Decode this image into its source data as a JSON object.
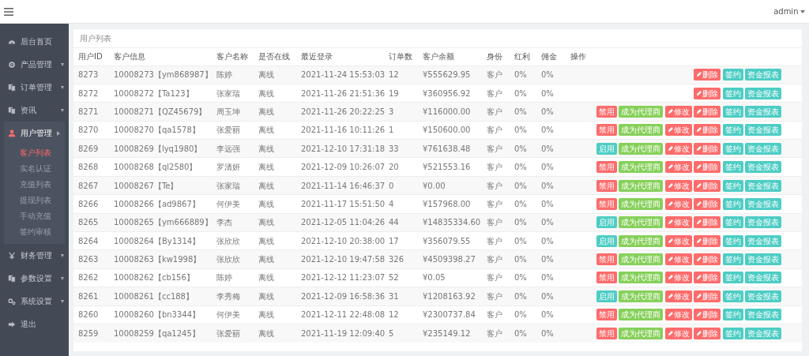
{
  "topbar": {
    "user": "admin"
  },
  "sidebar": {
    "items": [
      {
        "label": "后台首页",
        "selected": false
      },
      {
        "label": "产品管理",
        "selected": false,
        "expanded": false
      },
      {
        "label": "订单管理",
        "selected": false,
        "expanded": false
      },
      {
        "label": "资讯",
        "selected": false,
        "expanded": false
      },
      {
        "label": "用户管理",
        "selected": true,
        "expanded": true,
        "children": [
          {
            "label": "客户列表",
            "selected": true
          },
          {
            "label": "实名认证",
            "selected": false
          },
          {
            "label": "充值列表",
            "selected": false
          },
          {
            "label": "提现列表",
            "selected": false
          },
          {
            "label": "手动充值",
            "selected": false
          },
          {
            "label": "签约审核",
            "selected": false
          }
        ]
      },
      {
        "label": "财务管理",
        "selected": false,
        "expanded": false
      },
      {
        "label": "参数设置",
        "selected": false,
        "expanded": false
      },
      {
        "label": "系统设置",
        "selected": false,
        "expanded": false
      },
      {
        "label": "退出",
        "selected": false
      }
    ]
  },
  "panel": {
    "title": "用户列表",
    "table": {
      "columns": [
        "用户ID",
        "客户信息",
        "客户名称",
        "是否在线",
        "最近登录",
        "订单数",
        "客户余额",
        "身份",
        "红利",
        "佣金",
        "操作"
      ],
      "rows": [
        {
          "cells": [
            "8273",
            "10008273【ym868987】",
            "陈婷",
            "离线",
            "2021-11-24 15:53:03",
            "12",
            "¥555629.95",
            "客户",
            "0%",
            "0%"
          ],
          "actions": [
            {
              "label": "删除",
              "kind": "edit"
            },
            {
              "label": "签约",
              "kind": "info"
            },
            {
              "label": "资金报表",
              "kind": "info"
            }
          ]
        },
        {
          "cells": [
            "8272",
            "10008272【Ta123】",
            "张家瑞",
            "离线",
            "2021-11-26 21:51:36",
            "19",
            "¥360956.92",
            "客户",
            "0%",
            "0%"
          ],
          "actions": [
            {
              "label": "删除",
              "kind": "edit"
            },
            {
              "label": "签约",
              "kind": "info"
            },
            {
              "label": "资金报表",
              "kind": "info"
            }
          ]
        },
        {
          "cells": [
            "8271",
            "10008271【QZ45679】",
            "周玉坤",
            "离线",
            "2021-11-26 20:22:25",
            "3",
            "¥116000.00",
            "客户",
            "0%",
            "0%"
          ],
          "actions": [
            {
              "label": "禁用",
              "kind": "danger"
            },
            {
              "label": "成为代理商",
              "kind": "success"
            },
            {
              "label": "修改",
              "kind": "edit"
            },
            {
              "label": "删除",
              "kind": "edit"
            },
            {
              "label": "签约",
              "kind": "info"
            },
            {
              "label": "资金报表",
              "kind": "info"
            }
          ]
        },
        {
          "cells": [
            "8270",
            "10008270【qa1578】",
            "张爱丽",
            "离线",
            "2021-11-16 10:11:26",
            "1",
            "¥150600.00",
            "客户",
            "0%",
            "0%"
          ],
          "actions": [
            {
              "label": "禁用",
              "kind": "danger"
            },
            {
              "label": "成为代理商",
              "kind": "success"
            },
            {
              "label": "修改",
              "kind": "edit"
            },
            {
              "label": "删除",
              "kind": "edit"
            },
            {
              "label": "签约",
              "kind": "info"
            },
            {
              "label": "资金报表",
              "kind": "info"
            }
          ]
        },
        {
          "cells": [
            "8269",
            "10008269【lyq1980】",
            "李远强",
            "离线",
            "2021-12-10 17:31:18",
            "33",
            "¥761638.48",
            "客户",
            "0%",
            "0%"
          ],
          "actions": [
            {
              "label": "启用",
              "kind": "info"
            },
            {
              "label": "成为代理商",
              "kind": "success"
            },
            {
              "label": "修改",
              "kind": "edit"
            },
            {
              "label": "删除",
              "kind": "edit"
            },
            {
              "label": "签约",
              "kind": "info"
            },
            {
              "label": "资金报表",
              "kind": "info"
            }
          ]
        },
        {
          "cells": [
            "8268",
            "10008268【ql2580】",
            "罗清妍",
            "离线",
            "2021-12-09 10:26:07",
            "20",
            "¥521553.16",
            "客户",
            "0%",
            "0%"
          ],
          "actions": [
            {
              "label": "禁用",
              "kind": "danger"
            },
            {
              "label": "成为代理商",
              "kind": "success"
            },
            {
              "label": "修改",
              "kind": "edit"
            },
            {
              "label": "删除",
              "kind": "edit"
            },
            {
              "label": "签约",
              "kind": "info"
            },
            {
              "label": "资金报表",
              "kind": "info"
            }
          ]
        },
        {
          "cells": [
            "8267",
            "10008267【Te】",
            "张家瑞",
            "离线",
            "2021-11-14 16:46:37",
            "0",
            "¥0.00",
            "客户",
            "0%",
            "0%"
          ],
          "actions": [
            {
              "label": "禁用",
              "kind": "danger"
            },
            {
              "label": "成为代理商",
              "kind": "success"
            },
            {
              "label": "修改",
              "kind": "edit"
            },
            {
              "label": "删除",
              "kind": "edit"
            },
            {
              "label": "签约",
              "kind": "info"
            },
            {
              "label": "资金报表",
              "kind": "info"
            }
          ]
        },
        {
          "cells": [
            "8266",
            "10008266【ad9867】",
            "何伊美",
            "离线",
            "2021-11-17 15:51:50",
            "4",
            "¥157968.00",
            "客户",
            "0%",
            "0%"
          ],
          "actions": [
            {
              "label": "禁用",
              "kind": "danger"
            },
            {
              "label": "成为代理商",
              "kind": "success"
            },
            {
              "label": "修改",
              "kind": "edit"
            },
            {
              "label": "删除",
              "kind": "edit"
            },
            {
              "label": "签约",
              "kind": "info"
            },
            {
              "label": "资金报表",
              "kind": "info"
            }
          ]
        },
        {
          "cells": [
            "8265",
            "10008265【ym666889】",
            "李杰",
            "离线",
            "2021-12-05 11:04:26",
            "44",
            "¥14835334.60",
            "客户",
            "0%",
            "0%"
          ],
          "actions": [
            {
              "label": "启用",
              "kind": "info"
            },
            {
              "label": "成为代理商",
              "kind": "success"
            },
            {
              "label": "修改",
              "kind": "edit"
            },
            {
              "label": "删除",
              "kind": "edit"
            },
            {
              "label": "签约",
              "kind": "info"
            },
            {
              "label": "资金报表",
              "kind": "info"
            }
          ]
        },
        {
          "cells": [
            "8264",
            "10008264【By1314】",
            "张欣欣",
            "离线",
            "2021-12-10 20:38:00",
            "17",
            "¥356079.55",
            "客户",
            "0%",
            "0%"
          ],
          "actions": [
            {
              "label": "启用",
              "kind": "info"
            },
            {
              "label": "成为代理商",
              "kind": "success"
            },
            {
              "label": "修改",
              "kind": "edit"
            },
            {
              "label": "删除",
              "kind": "edit"
            },
            {
              "label": "签约",
              "kind": "info"
            },
            {
              "label": "资金报表",
              "kind": "info"
            }
          ]
        },
        {
          "cells": [
            "8263",
            "10008263【kw1998】",
            "张欣欣",
            "离线",
            "2021-12-10 19:47:58",
            "326",
            "¥4509398.27",
            "客户",
            "0%",
            "0%"
          ],
          "actions": [
            {
              "label": "禁用",
              "kind": "danger"
            },
            {
              "label": "成为代理商",
              "kind": "success"
            },
            {
              "label": "修改",
              "kind": "edit"
            },
            {
              "label": "删除",
              "kind": "edit"
            },
            {
              "label": "签约",
              "kind": "info"
            },
            {
              "label": "资金报表",
              "kind": "info"
            }
          ]
        },
        {
          "cells": [
            "8262",
            "10008262【cb156】",
            "陈婷",
            "离线",
            "2021-12-12 11:23:07",
            "52",
            "¥0.05",
            "客户",
            "0%",
            "0%"
          ],
          "actions": [
            {
              "label": "禁用",
              "kind": "danger"
            },
            {
              "label": "成为代理商",
              "kind": "success"
            },
            {
              "label": "修改",
              "kind": "edit"
            },
            {
              "label": "删除",
              "kind": "edit"
            },
            {
              "label": "签约",
              "kind": "info"
            },
            {
              "label": "资金报表",
              "kind": "info"
            }
          ]
        },
        {
          "cells": [
            "8261",
            "10008261【cc188】",
            "李秀梅",
            "离线",
            "2021-12-09 16:58:36",
            "31",
            "¥1208163.92",
            "客户",
            "0%",
            "0%"
          ],
          "actions": [
            {
              "label": "启用",
              "kind": "info"
            },
            {
              "label": "成为代理商",
              "kind": "success"
            },
            {
              "label": "修改",
              "kind": "edit"
            },
            {
              "label": "删除",
              "kind": "edit"
            },
            {
              "label": "签约",
              "kind": "info"
            },
            {
              "label": "资金报表",
              "kind": "info"
            }
          ]
        },
        {
          "cells": [
            "8260",
            "10008260【bn3344】",
            "何伊美",
            "离线",
            "2021-12-11 22:48:08",
            "12",
            "¥2300737.84",
            "客户",
            "0%",
            "0%"
          ],
          "actions": [
            {
              "label": "禁用",
              "kind": "danger"
            },
            {
              "label": "成为代理商",
              "kind": "success"
            },
            {
              "label": "修改",
              "kind": "edit"
            },
            {
              "label": "删除",
              "kind": "edit"
            },
            {
              "label": "签约",
              "kind": "info"
            },
            {
              "label": "资金报表",
              "kind": "info"
            }
          ]
        },
        {
          "cells": [
            "8259",
            "10008259【qa1245】",
            "张爱丽",
            "离线",
            "2021-11-19 12:09:40",
            "5",
            "¥235149.12",
            "客户",
            "0%",
            "0%"
          ],
          "actions": [
            {
              "label": "禁用",
              "kind": "danger"
            },
            {
              "label": "成为代理商",
              "kind": "success"
            },
            {
              "label": "修改",
              "kind": "edit"
            },
            {
              "label": "删除",
              "kind": "edit"
            },
            {
              "label": "签约",
              "kind": "info"
            },
            {
              "label": "资金报表",
              "kind": "info"
            }
          ]
        }
      ]
    }
  }
}
